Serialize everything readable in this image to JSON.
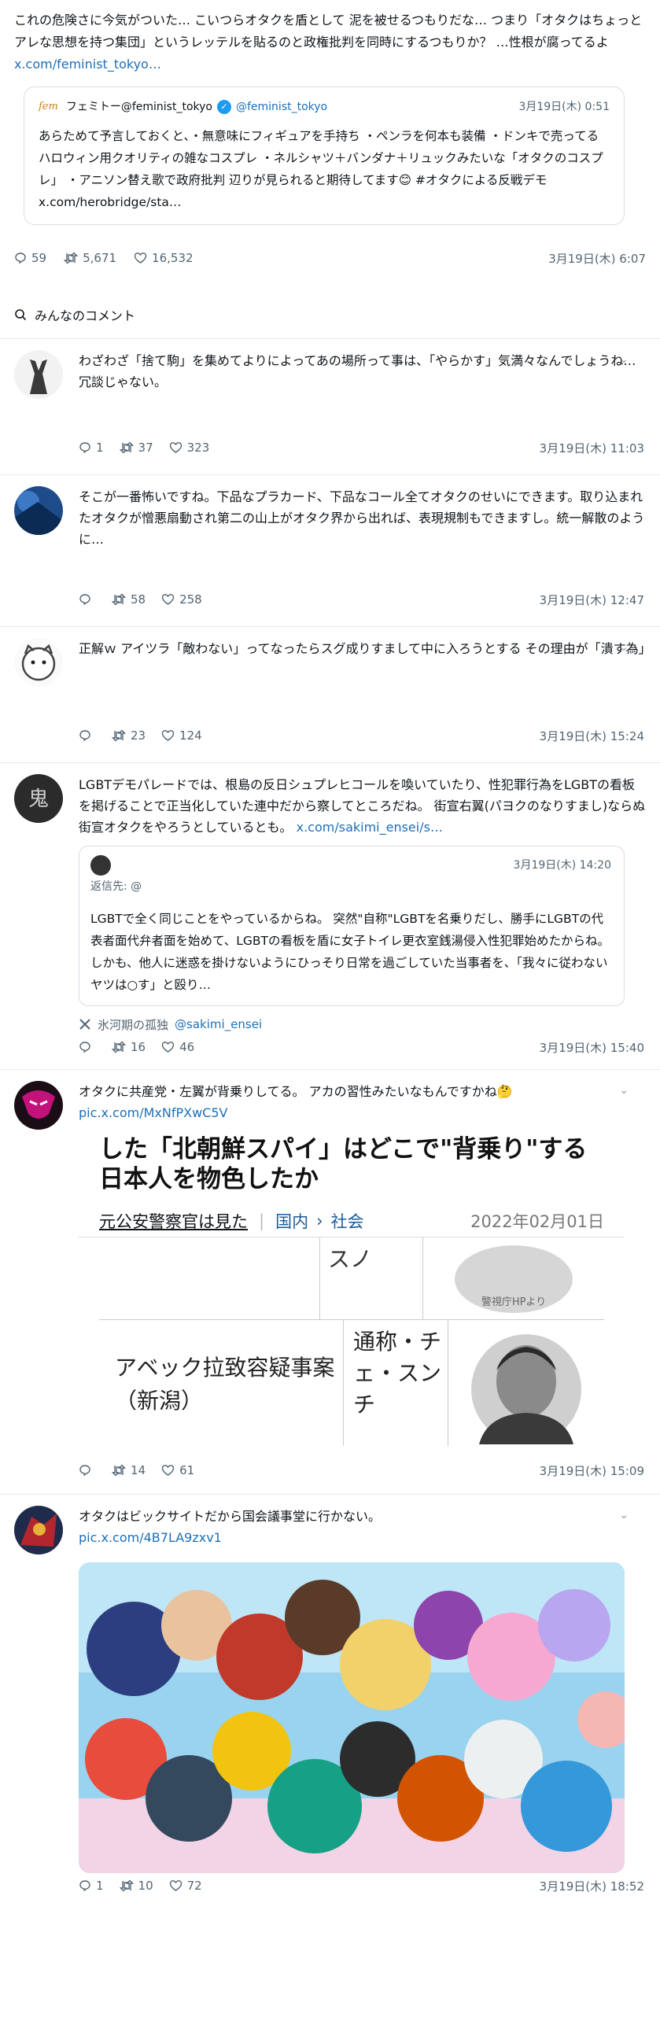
{
  "top_post": {
    "text": "これの危険さに今気がついた… こいつらオタクを盾として 泥を被せるつもりだな… つまり「オタクはちょっとアレな思想を持つ集団」というレッテルを貼るのと政権批判を同時にするつもりか？ …性根が腐ってるよ ",
    "link": "x.com/feminist_tokyo…",
    "quote": {
      "logo": "fem",
      "name": "フェミトー@feminist_tokyo",
      "handle": "@feminist_tokyo",
      "time": "3月19日(木) 0:51",
      "text": "あらためて予言しておくと、・無意味にフィギュアを手持ち ・ペンラを何本も装備 ・ドンキで売ってるハロウィン用クオリティの雑なコスプレ ・ネルシャツ＋バンダナ＋リュックみたいな「オタクのコスプレ」 ・アニソン替え歌で政府批判 辺りが見られると期待してます😊 #オタクによる反戦デモ",
      "link": "x.com/herobridge/sta…"
    },
    "replies": "59",
    "retweets": "5,671",
    "likes": "16,532",
    "time": "3月19日(木) 6:07"
  },
  "comments_section": {
    "title": "みんなのコメント"
  },
  "comments": [
    {
      "text": "わざわざ「捨て駒」を集めてよりによってあの場所って事は、「やらかす」気満々なんでしょうね…冗談じゃない。",
      "replies": "1",
      "retweets": "37",
      "likes": "323",
      "time": "3月19日(木) 11:03"
    },
    {
      "text": "そこが一番怖いですね。下品なプラカード、下品なコール全てオタクのせいにできます。取り込まれたオタクが憎悪扇動され第二の山上がオタク界から出れば、表現規制もできますし。統一解散のように…",
      "replies": "",
      "retweets": "58",
      "likes": "258",
      "time": "3月19日(木) 12:47"
    },
    {
      "text": "正解ｗ アイツラ「敵わない」ってなったらスグ成りすまして中に入ろうとする その理由が「潰す為」",
      "replies": "",
      "retweets": "23",
      "likes": "124",
      "time": "3月19日(木) 15:24"
    },
    {
      "text": "LGBTデモパレードでは、根島の反日シュプレヒコールを喚いていたり、性犯罪行為をLGBTの看板を掲げることで正当化していた連中だから察してところだね。 街宣右翼(パヨクのなりすまし)ならぬ街宣オタクをやろうとしているとも。 ",
      "link": "x.com/sakimi_ensei/s…",
      "quote": {
        "name": "",
        "time": "3月19日(木) 14:20",
        "reply_to": "返信先: @",
        "text": "LGBTで全く同じことをやっているからね。 突然\"自称\"LGBTを名乗りだし、勝手にLGBTの代表者面代弁者面を始めて、LGBTの看板を盾に女子トイレ更衣室銭湯侵入性犯罪始めたからね。 しかも、他人に迷惑を掛けないようにひっそり日常を過ごしていた当事者を、「我々に従わないヤツは○す」と殴り…"
      },
      "x_name": "氷河期の孤独",
      "x_handle": "@sakimi_ensei",
      "replies": "",
      "retweets": "16",
      "likes": "46",
      "time": "3月19日(木) 15:40"
    },
    {
      "text": "オタクに共産党・左翼が背乗りしてる。 アカの習性みたいなもんですかね🤔 ",
      "link": "pic.x.com/MxNfPXwC5V",
      "image": {
        "headline": "した「北朝鮮スパイ」はどこで\"背乗り\"する日本人を物色したか",
        "source": "元公安警察官は見た",
        "crumb1": "国内",
        "crumb2": "社会",
        "date": "2022年02月01日",
        "cell_top": "スノ",
        "cell_photo_caption": "警視庁HPより",
        "case": "アベック拉致容疑事案（新潟）",
        "alias": "通称・チェ・スンチ"
      },
      "replies": "",
      "retweets": "14",
      "likes": "61",
      "time": "3月19日(木) 15:09"
    },
    {
      "text": "オタクはビックサイトだから国会議事堂に行かない。",
      "link": "pic.x.com/4B7LA9zxv1",
      "replies": "1",
      "retweets": "10",
      "likes": "72",
      "time": "3月19日(木) 18:52"
    }
  ],
  "colors": {
    "link": "#1d6fb8",
    "muted": "#536471",
    "verified": "#1d9bf0"
  },
  "icons": [
    "reply-icon",
    "retweet-icon",
    "like-icon",
    "search-icon",
    "verified-icon",
    "x-logo-icon",
    "more-icon"
  ]
}
